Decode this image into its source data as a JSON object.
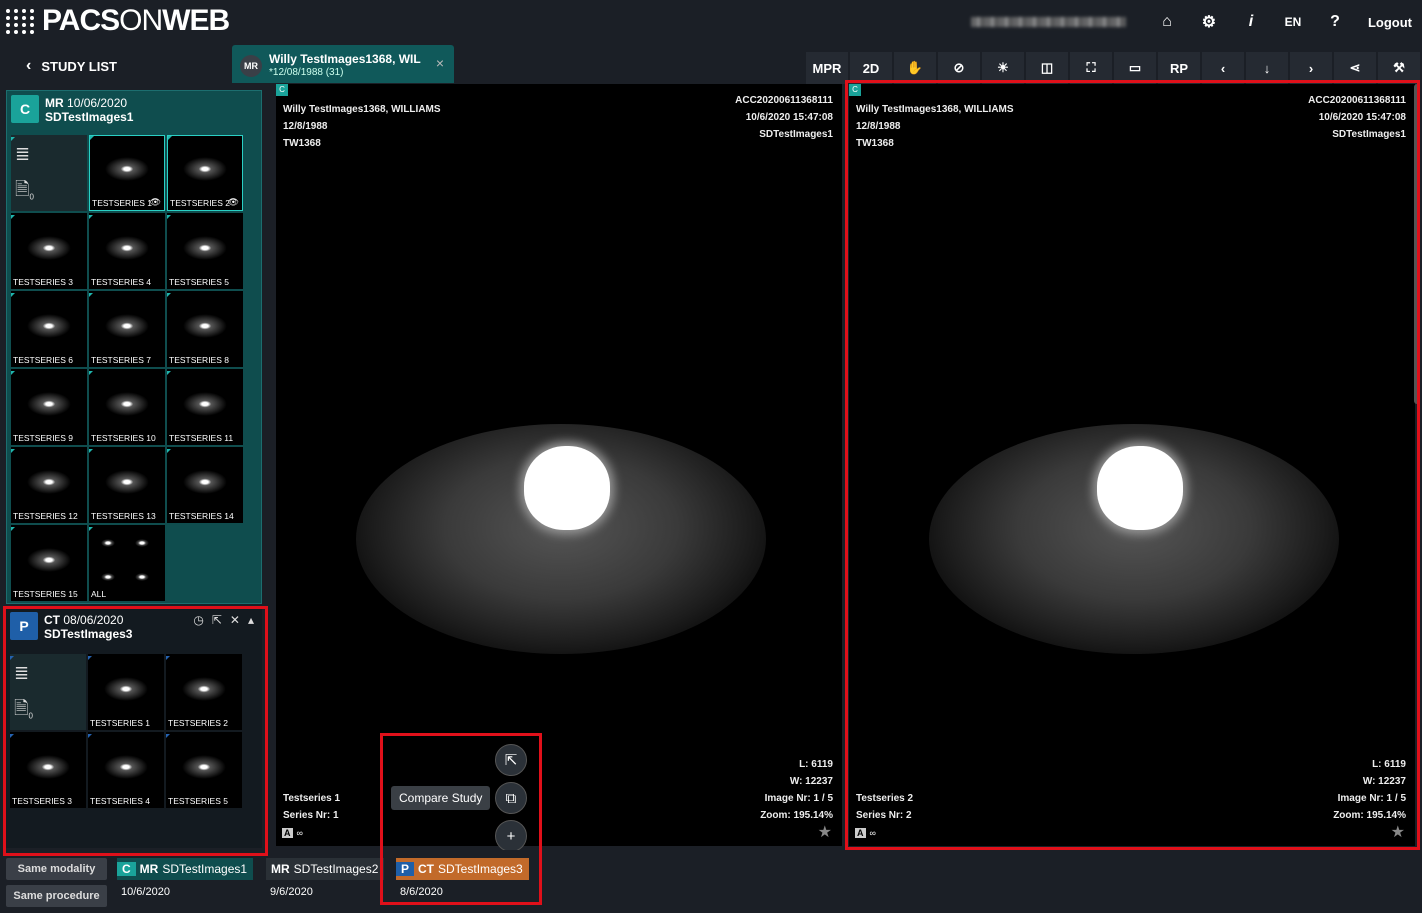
{
  "app": {
    "logo_bold": "PACS",
    "logo_light": "ON",
    "logo_end": "WEB"
  },
  "top": {
    "lang": "EN",
    "help": "?",
    "info": "i",
    "logout": "Logout"
  },
  "nav": {
    "back_label": "STUDY LIST"
  },
  "tab": {
    "modality": "MR",
    "name": "Willy TestImages1368, WIL",
    "dob": "*12/08/1988 (31)",
    "close": "×"
  },
  "toolbar": [
    "MPR",
    "2D",
    "✋",
    "⊘",
    "☀",
    "◫",
    "⛶",
    "▭",
    "RP",
    "‹",
    "↓",
    "›",
    "⋖",
    "⚒"
  ],
  "studies": [
    {
      "badge": "C",
      "modality": "MR",
      "date": "10/06/2020",
      "name": "SDTestImages1",
      "doc_count": "0",
      "series": [
        "TESTSERIES 1",
        "TESTSERIES 2",
        "TESTSERIES 3",
        "TESTSERIES 4",
        "TESTSERIES 5",
        "TESTSERIES 6",
        "TESTSERIES 7",
        "TESTSERIES 8",
        "TESTSERIES 9",
        "TESTSERIES 10",
        "TESTSERIES 11",
        "TESTSERIES 12",
        "TESTSERIES 13",
        "TESTSERIES 14",
        "TESTSERIES 15",
        "ALL"
      ]
    },
    {
      "badge": "P",
      "modality": "CT",
      "date": "08/06/2020",
      "name": "SDTestImages3",
      "doc_count": "0",
      "series": [
        "TESTSERIES 1",
        "TESTSERIES 2",
        "TESTSERIES 3",
        "TESTSERIES 4",
        "TESTSERIES 5"
      ]
    }
  ],
  "viewports": [
    {
      "badge": "C",
      "patient": "Willy TestImages1368, WILLIAMS",
      "dob": "12/8/1988",
      "pid": "TW1368",
      "acc": "ACC20200611368111",
      "datetime": "10/6/2020 15:47:08",
      "study": "SDTestImages1",
      "series": "Testseries 1",
      "series_nr": "Series Nr: 1",
      "level": "L: 6119",
      "window": "W: 12237",
      "image_nr": "Image Nr: 1 / 5",
      "zoom": "Zoom: 195.14%"
    },
    {
      "badge": "C",
      "patient": "Willy TestImages1368, WILLIAMS",
      "dob": "12/8/1988",
      "pid": "TW1368",
      "acc": "ACC20200611368111",
      "datetime": "10/6/2020 15:47:08",
      "study": "SDTestImages1",
      "series": "Testseries 2",
      "series_nr": "Series Nr: 2",
      "level": "L: 6119",
      "window": "W: 12237",
      "image_nr": "Image Nr: 1 / 5",
      "zoom": "Zoom: 195.14%"
    }
  ],
  "compare": {
    "tooltip": "Compare Study"
  },
  "filters": {
    "same_modality": "Same modality",
    "same_procedure": "Same procedure"
  },
  "bottom_studies": [
    {
      "badge": "C",
      "modality": "MR",
      "name": "SDTestImages1",
      "date": "10/6/2020"
    },
    {
      "badge": "",
      "modality": "MR",
      "name": "SDTestImages2",
      "date": "9/6/2020"
    },
    {
      "badge": "P",
      "modality": "CT",
      "name": "SDTestImages3",
      "date": "8/6/2020"
    }
  ],
  "colors": {
    "teal": "#1aa39a",
    "blue": "#1f5fa8",
    "orange": "#c26a2a",
    "highlight": "#e0101a"
  }
}
